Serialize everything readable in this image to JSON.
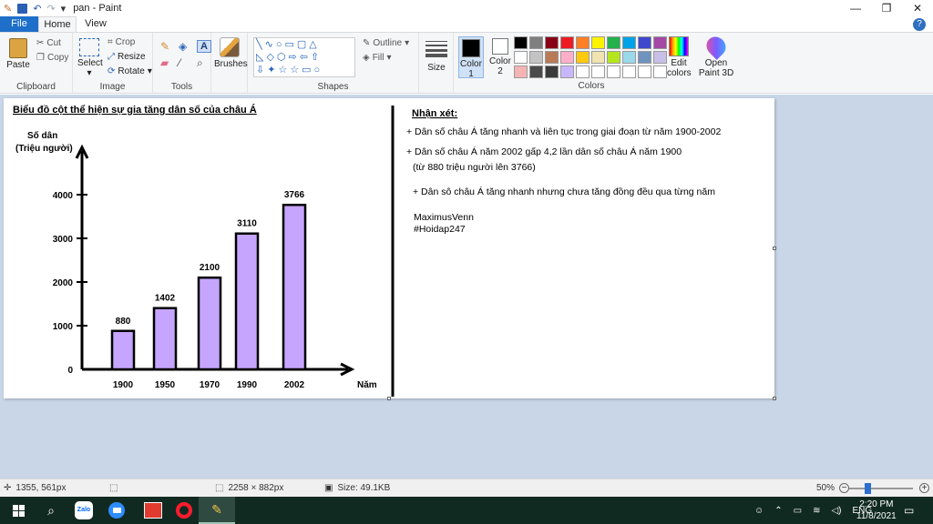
{
  "window": {
    "title": "pan - Paint",
    "controls": [
      "—",
      "❐",
      "✕"
    ]
  },
  "tabs": {
    "file": "File",
    "home": "Home",
    "view": "View",
    "help": "?"
  },
  "ribbon": {
    "clipboard": {
      "paste": "Paste",
      "cut": "Cut",
      "copy": "Copy",
      "label": "Clipboard"
    },
    "image": {
      "select": "Select",
      "crop": "Crop",
      "resize": "Resize",
      "rotate": "Rotate",
      "label": "Image"
    },
    "tools": {
      "label": "Tools"
    },
    "brushes": {
      "label": "Brushes"
    },
    "shapes": {
      "outline": "Outline",
      "fill": "Fill",
      "label": "Shapes"
    },
    "size": {
      "label": "Size"
    },
    "color1": {
      "label": "Color",
      "num": "1"
    },
    "color2": {
      "label": "Color",
      "num": "2"
    },
    "colors": {
      "label": "Colors",
      "palette": [
        "#000000",
        "#7f7f7f",
        "#880015",
        "#ed1c24",
        "#ff7f27",
        "#fff200",
        "#22b14c",
        "#00a2e8",
        "#3f48cc",
        "#a349a4",
        "#ffffff",
        "#c3c3c3",
        "#b97a57",
        "#ffaec9",
        "#ffc90e",
        "#efe4b0",
        "#b5e61d",
        "#99d9ea",
        "#7092be",
        "#c8bfe7",
        "#f5b4b4",
        "#4a4a4a",
        "#3a3a3a",
        "#c8b7ff",
        "#ffffff",
        "#ffffff",
        "#ffffff",
        "#ffffff",
        "#ffffff",
        "#ffffff"
      ]
    },
    "edit_colors": {
      "line1": "Edit",
      "line2": "colors"
    },
    "paint3d": {
      "line1": "Open",
      "line2": "Paint 3D"
    }
  },
  "canvas_content": {
    "chart_title": "Biểu đồ cột thể hiện sự gia tăng dân số của châu Á",
    "ylabel_line1": "Số dân",
    "ylabel_line2": "(Triệu người)",
    "xlabel": "Năm",
    "notes_title": "Nhận xét:",
    "note1": "+ Dân số châu Á tăng nhanh và liên tục trong giai đoạn từ năm 1900-2002",
    "note2a": "+ Dân số châu Á năm 2002 gấp 4,2 lần dân số châu Á năm 1900",
    "note2b": "(từ 880 triệu người lên 3766)",
    "note3": "+ Dân sô châu Á tăng nhanh nhưng chưa tăng đồng đều qua từng năm",
    "author": "MaximusVenn",
    "tag": "#Hoidap247"
  },
  "chart_data": {
    "type": "bar",
    "title": "Biểu đồ cột thể hiện sự gia tăng dân số của châu Á",
    "ylabel": "Số dân (Triệu người)",
    "xlabel": "Năm",
    "categories": [
      "1900",
      "1950",
      "1970",
      "1990",
      "2002"
    ],
    "values": [
      880,
      1402,
      2100,
      3110,
      3766
    ],
    "yticks": [
      0,
      1000,
      2000,
      3000,
      4000
    ],
    "ylim": [
      0,
      4000
    ],
    "bar_color": "#c6a5ff"
  },
  "statusbar": {
    "cursor": "1355, 561px",
    "dimensions": "2258 × 882px",
    "size": "Size: 49.1KB",
    "zoom": "50%"
  },
  "taskbar": {
    "apps": [
      "windows-start",
      "search",
      "zalo",
      "zoom",
      "newsapp",
      "opera",
      "paint"
    ],
    "zalo_label": "Zalo",
    "lang": "ENG",
    "time": "2:20 PM",
    "date": "11/8/2021"
  }
}
